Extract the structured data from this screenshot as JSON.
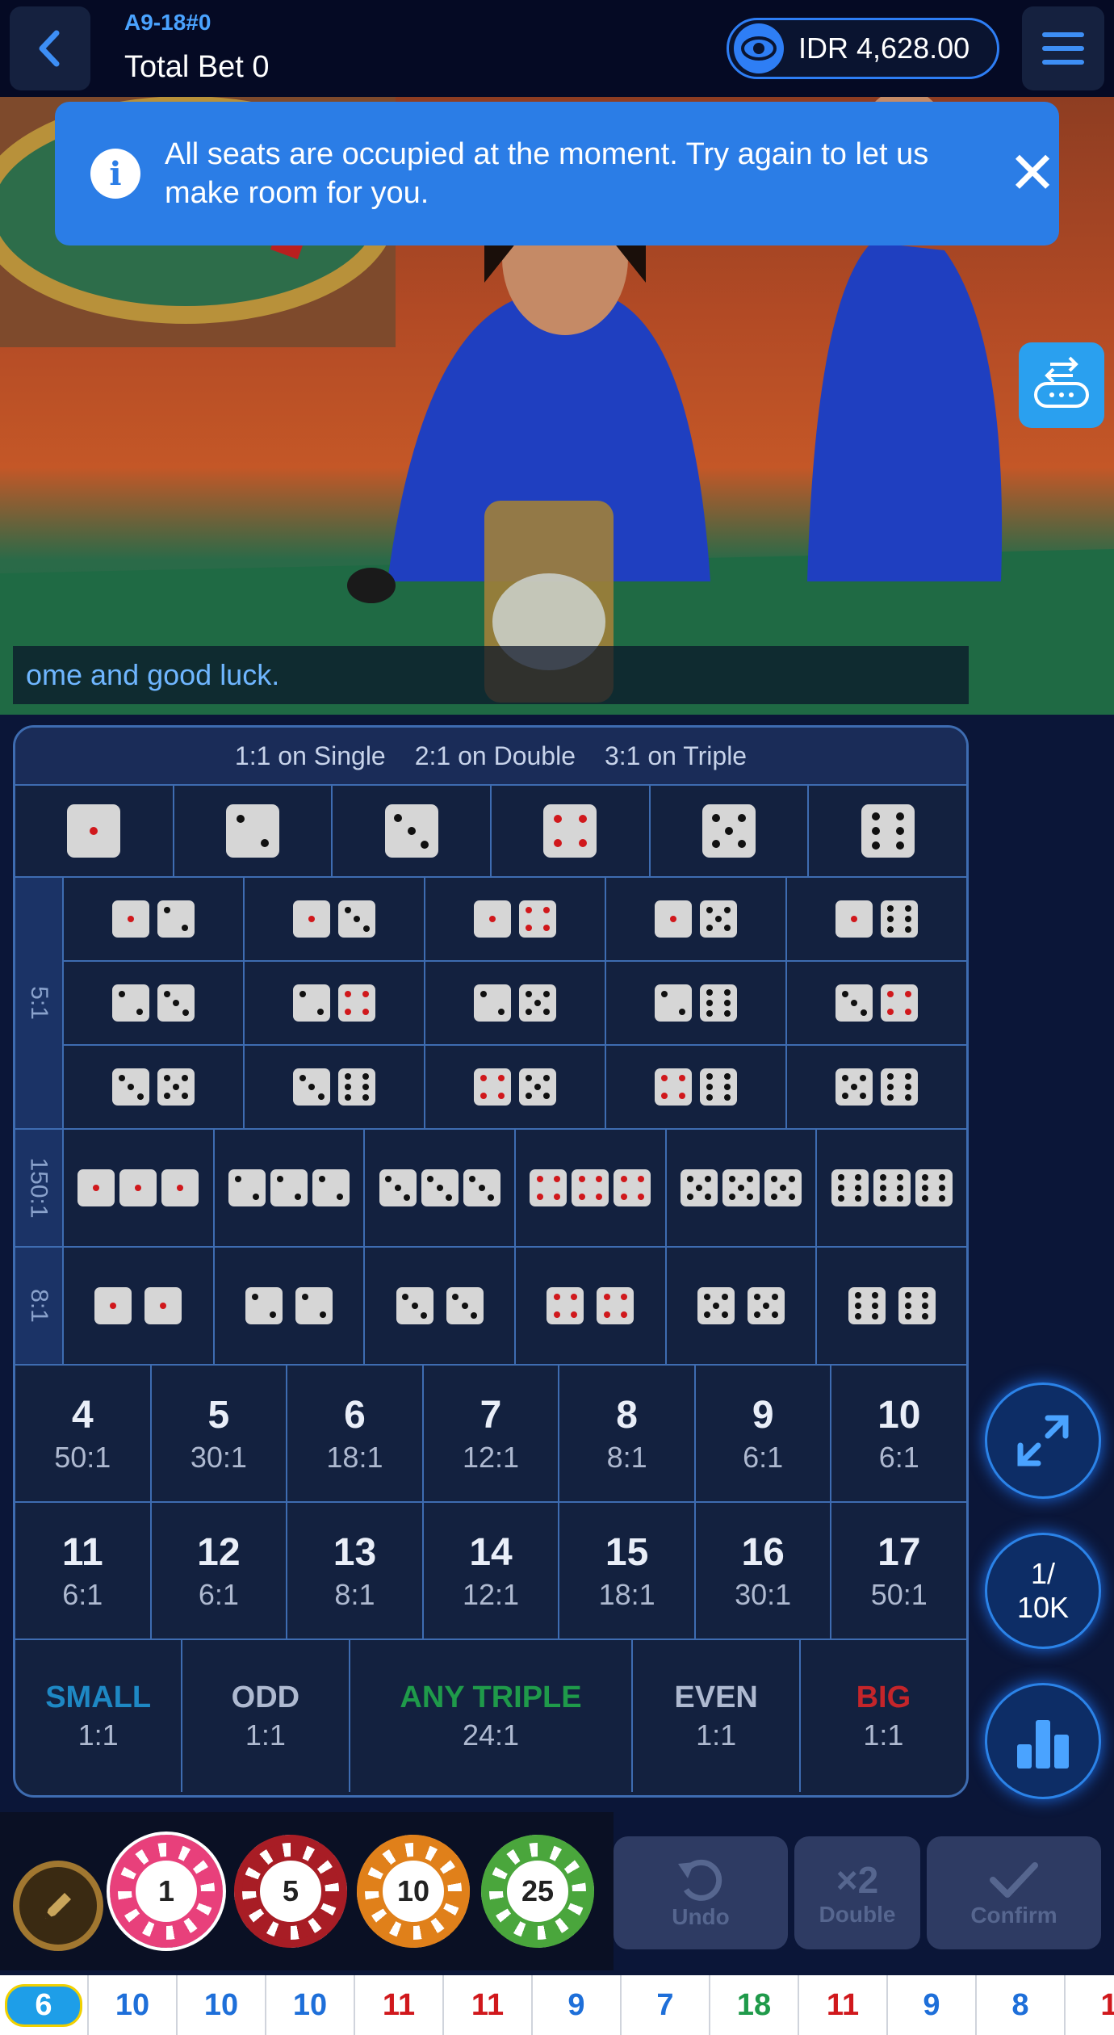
{
  "header": {
    "table_id": "A9-18#0",
    "total_bet": "Total Bet 0",
    "balance": "IDR 4,628.00"
  },
  "notice": {
    "message": "All seats are occupied at the moment. Try again to let us make room for you.",
    "close": "✕",
    "info": "i"
  },
  "ticker": "ome and good luck.",
  "board": {
    "payout_header": [
      "1:1 on Single",
      "2:1 on Double",
      "3:1 on Triple"
    ],
    "singles": [
      1,
      2,
      3,
      4,
      5,
      6
    ],
    "side_labels": {
      "pairs": "5:1",
      "triples": "150:1",
      "doubles": "8:1"
    },
    "combos": [
      [
        [
          1,
          2
        ],
        [
          1,
          3
        ],
        [
          1,
          4
        ],
        [
          1,
          5
        ],
        [
          1,
          6
        ]
      ],
      [
        [
          2,
          3
        ],
        [
          2,
          4
        ],
        [
          2,
          5
        ],
        [
          2,
          6
        ],
        [
          3,
          4
        ]
      ],
      [
        [
          3,
          5
        ],
        [
          3,
          6
        ],
        [
          4,
          5
        ],
        [
          4,
          6
        ],
        [
          5,
          6
        ]
      ]
    ],
    "triples": [
      1,
      2,
      3,
      4,
      5,
      6
    ],
    "doubles": [
      1,
      2,
      3,
      4,
      5,
      6
    ],
    "totals_row1": [
      {
        "n": "4",
        "p": "50:1"
      },
      {
        "n": "5",
        "p": "30:1"
      },
      {
        "n": "6",
        "p": "18:1"
      },
      {
        "n": "7",
        "p": "12:1"
      },
      {
        "n": "8",
        "p": "8:1"
      },
      {
        "n": "9",
        "p": "6:1"
      },
      {
        "n": "10",
        "p": "6:1"
      }
    ],
    "totals_row2": [
      {
        "n": "11",
        "p": "6:1"
      },
      {
        "n": "12",
        "p": "6:1"
      },
      {
        "n": "13",
        "p": "8:1"
      },
      {
        "n": "14",
        "p": "12:1"
      },
      {
        "n": "15",
        "p": "18:1"
      },
      {
        "n": "16",
        "p": "30:1"
      },
      {
        "n": "17",
        "p": "50:1"
      }
    ],
    "bottom_bets": [
      {
        "label": "SMALL",
        "payout": "1:1",
        "color": "#1e88c4"
      },
      {
        "label": "ODD",
        "payout": "1:1",
        "color": "#aeb9d0"
      },
      {
        "label": "ANY TRIPLE",
        "payout": "24:1",
        "color": "#1f9a4a"
      },
      {
        "label": "EVEN",
        "payout": "1:1",
        "color": "#aeb9d0"
      },
      {
        "label": "BIG",
        "payout": "1:1",
        "color": "#c4252a"
      }
    ]
  },
  "side_buttons": {
    "limit_top": "1/",
    "limit_bottom": "10K"
  },
  "chips": [
    {
      "value": "1",
      "color": "#e8407b"
    },
    {
      "value": "5",
      "color": "#a81d25"
    },
    {
      "value": "10",
      "color": "#e0801a"
    },
    {
      "value": "25",
      "color": "#4aa63c"
    }
  ],
  "actions": {
    "undo": "Undo",
    "double": "Double",
    "double_icon": "×2",
    "confirm": "Confirm"
  },
  "history": [
    {
      "v": "6",
      "c": "#ffffff",
      "badge": true
    },
    {
      "v": "10",
      "c": "#1e6fd9"
    },
    {
      "v": "10",
      "c": "#1e6fd9"
    },
    {
      "v": "10",
      "c": "#1e6fd9"
    },
    {
      "v": "11",
      "c": "#d0181c"
    },
    {
      "v": "11",
      "c": "#d0181c"
    },
    {
      "v": "9",
      "c": "#1e6fd9"
    },
    {
      "v": "7",
      "c": "#1e6fd9"
    },
    {
      "v": "18",
      "c": "#1f9a4a"
    },
    {
      "v": "11",
      "c": "#d0181c"
    },
    {
      "v": "9",
      "c": "#1e6fd9"
    },
    {
      "v": "8",
      "c": "#1e6fd9"
    },
    {
      "v": "1",
      "c": "#d0181c"
    }
  ]
}
